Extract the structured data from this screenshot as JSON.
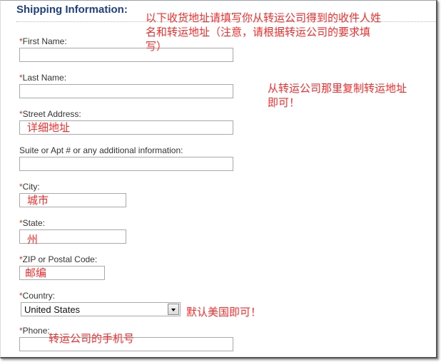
{
  "section": {
    "title": "Shipping Information:"
  },
  "fields": {
    "first_name": {
      "req": "*",
      "label": "First Name:",
      "value": ""
    },
    "last_name": {
      "req": "*",
      "label": "Last Name:",
      "value": ""
    },
    "street": {
      "req": "*",
      "label": "Street Address:",
      "hint": "详细地址"
    },
    "suite": {
      "req": "",
      "label": "Suite or Apt # or any additional information:",
      "value": ""
    },
    "city": {
      "req": "*",
      "label": "City:",
      "hint": "城市"
    },
    "state": {
      "req": "*",
      "label": "State:",
      "hint": "州"
    },
    "zip": {
      "req": "*",
      "label": "ZIP or Postal Code:",
      "hint": "邮编"
    },
    "country": {
      "req": "*",
      "label": "Country:",
      "selected": "United States"
    },
    "phone": {
      "req": "*",
      "label": "Phone:",
      "hint": "转运公司的手机号"
    }
  },
  "annotations": {
    "top_note_line1": "以下收货地址请填写你从转运公司得到的收件人姓",
    "top_note_line2": "名和转运地址（注意，请根据转运公司的要求填",
    "top_note_line3": "写）",
    "copy_note_line1": "从转运公司那里复制转运地址",
    "copy_note_line2": "即可！",
    "country_note": "默认美国即可！"
  },
  "colors": {
    "title": "#1f3f7f",
    "annotation": "#ff2a2a",
    "required": "#c0392b"
  }
}
